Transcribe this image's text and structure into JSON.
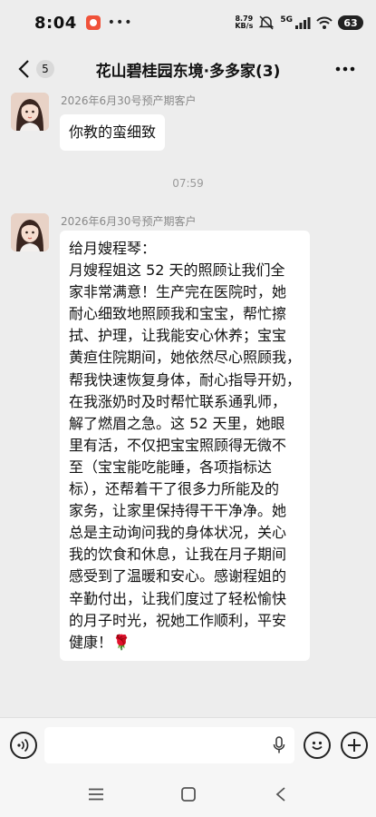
{
  "status_bar": {
    "time": "8:04",
    "net_speed_value": "8.79",
    "net_speed_unit": "KB/s",
    "network": "5G",
    "battery": "63"
  },
  "title_bar": {
    "unread_count": "5",
    "title": "花山碧桂园东境·多多家(3)"
  },
  "messages": [
    {
      "sender": "2026年6月30号预产期客户",
      "lines": [
        "你教的蛮细致"
      ]
    },
    {
      "sender": "2026年6月30号预产期客户",
      "lines": [
        "给月嫂程琴：",
        "月嫂程姐这 52 天的照顾让我们全",
        "家非常满意！生产完在医院时，她",
        "耐心细致地照顾我和宝宝，帮忙擦",
        "拭、护理，让我能安心休养；宝宝",
        "黄疸住院期间，她依然尽心照顾我，",
        "帮我快速恢复身体，耐心指导开奶，",
        "在我涨奶时及时帮忙联系通乳师，",
        "解了燃眉之急。这 52 天里，她眼",
        "里有活，不仅把宝宝照顾得无微不",
        "至（宝宝能吃能睡，各项指标达",
        "标），还帮着干了很多力所能及的",
        "家务，让家里保持得干干净净。她",
        "总是主动询问我的身体状况，关心",
        "我的饮食和休息，让我在月子期间",
        "感受到了温暖和安心。感谢程姐的",
        "辛勤付出，让我们度过了轻松愉快",
        "的月子时光，祝她工作顺利，平安",
        "健康！🌹"
      ]
    }
  ],
  "timestamp": "07:59",
  "input": {
    "placeholder": ""
  },
  "colors": {
    "background": "#ededed",
    "bubble": "#ffffff",
    "sender_text": "#888888"
  }
}
